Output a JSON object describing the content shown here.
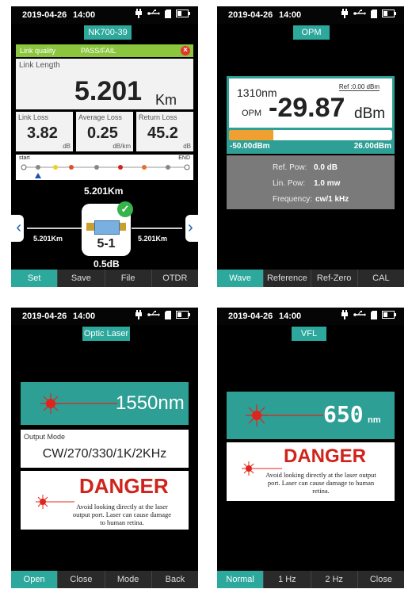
{
  "screen1": {
    "date": "2019-04-26",
    "time": "14:00",
    "title": "NK700-39",
    "link_quality_label": "Link quality",
    "link_quality_value": "PASS/FAIL",
    "link_length_label": "Link Length",
    "link_length_value": "5.201",
    "link_length_unit": "Km",
    "link_loss_label": "Link Loss",
    "link_loss_value": "3.82",
    "link_loss_unit": "dB",
    "avg_loss_label": "Average Loss",
    "avg_loss_value": "0.25",
    "avg_loss_unit": "dB/km",
    "return_loss_label": "Return Loss",
    "return_loss_value": "45.2",
    "return_loss_unit": "dB",
    "start_label": "start",
    "end_label": "END",
    "event_distance": "5.201Km",
    "left_distance": "5.201Km",
    "right_distance": "5.201Km",
    "event_id": "5-1",
    "event_loss": "0.5dB",
    "tabs": [
      "Set",
      "Save",
      "File",
      "OTDR"
    ]
  },
  "screen2": {
    "date": "2019-04-26",
    "time": "14:00",
    "title": "OPM",
    "wavelength": "1310nm",
    "ref": "Ref :0.00 dBm",
    "opm_label": "OPM",
    "power_value": "-29.87",
    "power_unit": "dBm",
    "power_level_fraction": 0.27,
    "range_min": "-50.00dBm",
    "range_max": "26.00dBm",
    "ref_pow_label": "Ref. Pow:",
    "ref_pow_value": "0.0 dB",
    "lin_pow_label": "Lin. Pow:",
    "lin_pow_value": "1.0 mw",
    "freq_label": "Frequency:",
    "freq_value": "cw/1 kHz",
    "tabs": [
      "Wave",
      "Reference",
      "Ref-Zero",
      "CAL"
    ]
  },
  "screen3": {
    "date": "2019-04-26",
    "time": "14:00",
    "title": "Optic Laser",
    "wavelength": "1550nm",
    "output_mode_label": "Output Mode",
    "output_mode_value": "CW/270/330/1K/2KHz",
    "danger": "DANGER",
    "warning": "Avoid looking directly at the laser output port. Laser can cause damage to human retina.",
    "tabs": [
      "Open",
      "Close",
      "Mode",
      "Back"
    ]
  },
  "screen4": {
    "date": "2019-04-26",
    "time": "14:00",
    "title": "VFL",
    "wavelength_value": "650",
    "wavelength_unit": "nm",
    "danger": "DANGER",
    "warning": "Avoid looking directly at the laser output port. Laser can cause damage to human retina.",
    "tabs": [
      "Normal",
      "1 Hz",
      "2 Hz",
      "Close"
    ]
  },
  "colors": {
    "teal": "#2ca89c",
    "danger_red": "#d0231b",
    "link_quality_green": "#8cc63f",
    "power_bar_orange": "#f0a030"
  }
}
